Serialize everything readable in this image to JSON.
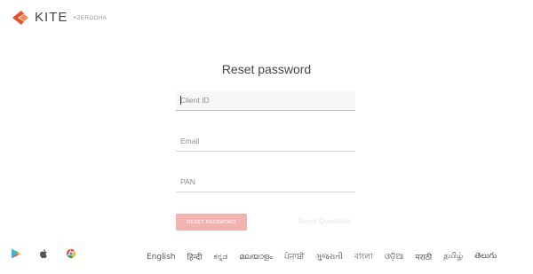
{
  "brand": {
    "name": "KITE",
    "sub": "ZERODHA",
    "accent": "#e8512a"
  },
  "form": {
    "title": "Reset password",
    "fields": [
      {
        "placeholder": "Client ID",
        "value": ""
      },
      {
        "placeholder": "Email",
        "value": ""
      },
      {
        "placeholder": "PAN",
        "value": ""
      }
    ],
    "submit_label": "RESET PASSWORD",
    "alt_link": "Reset Questions",
    "button_color": "#f2b3b0"
  },
  "footer": {
    "apps": [
      {
        "icon": "play-store-icon"
      },
      {
        "icon": "apple-icon"
      },
      {
        "icon": "chrome-icon"
      }
    ],
    "languages": [
      "English",
      "हिन्दी",
      "ಕನ್ನಡ",
      "മലയാളം",
      "ਪੰਜਾਬੀ",
      "ગુજરાતી",
      "বাংলা",
      "ଓଡ଼ିଆ",
      "मराठी",
      "தமிழ்",
      "తెలుగు"
    ]
  }
}
